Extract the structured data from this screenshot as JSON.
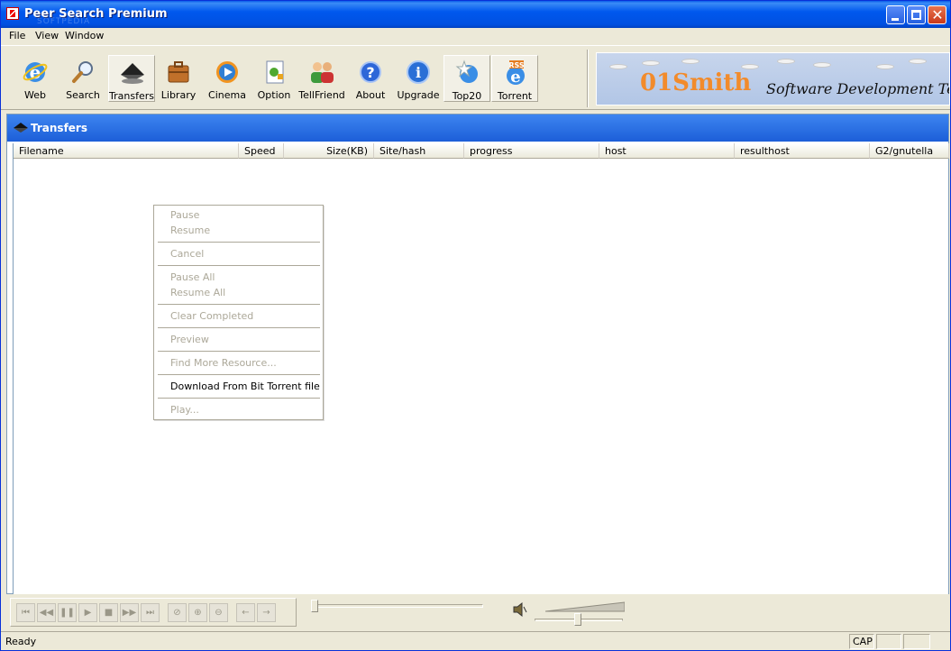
{
  "window": {
    "title": "Peer Search Premium",
    "watermark": "SOFTPEDIA"
  },
  "menu": [
    "File",
    "View",
    "Window"
  ],
  "toolbar": [
    {
      "label": "Web",
      "icon": "ie-globe-icon"
    },
    {
      "label": "Search",
      "icon": "magnifier-icon"
    },
    {
      "label": "Transfers",
      "icon": "transfers-icon"
    },
    {
      "label": "Library",
      "icon": "library-briefcase-icon"
    },
    {
      "label": "Cinema",
      "icon": "media-player-icon"
    },
    {
      "label": "Option",
      "icon": "options-icon"
    },
    {
      "label": "TellFriend",
      "icon": "friends-icon"
    },
    {
      "label": "About",
      "icon": "help-icon"
    },
    {
      "label": "Upgrade",
      "icon": "info-icon"
    },
    {
      "label": "Top20",
      "icon": "star-globe-icon"
    },
    {
      "label": "Torrent",
      "icon": "rss-torrent-icon"
    }
  ],
  "banner": {
    "brand": "01Smith",
    "slogan": "Software Development Tea"
  },
  "panel": {
    "title": "Transfers"
  },
  "columns": [
    "Filename",
    "Speed",
    "Size(KB)",
    "Site/hash",
    "progress",
    "host",
    "resulthost",
    "G2/gnutella"
  ],
  "context_menu": {
    "pause": "Pause",
    "resume": "Resume",
    "cancel": "Cancel",
    "pause_all": "Pause All",
    "resume_all": "Resume All",
    "clear_completed": "Clear Completed",
    "preview": "Preview",
    "find_more": "Find More Resource...",
    "download_torrent": "Download From Bit Torrent file",
    "play": "Play..."
  },
  "status": {
    "text": "Ready",
    "cap": "CAP"
  },
  "colors": {
    "accent": "#0058ee",
    "brand": "#f28b2b"
  }
}
